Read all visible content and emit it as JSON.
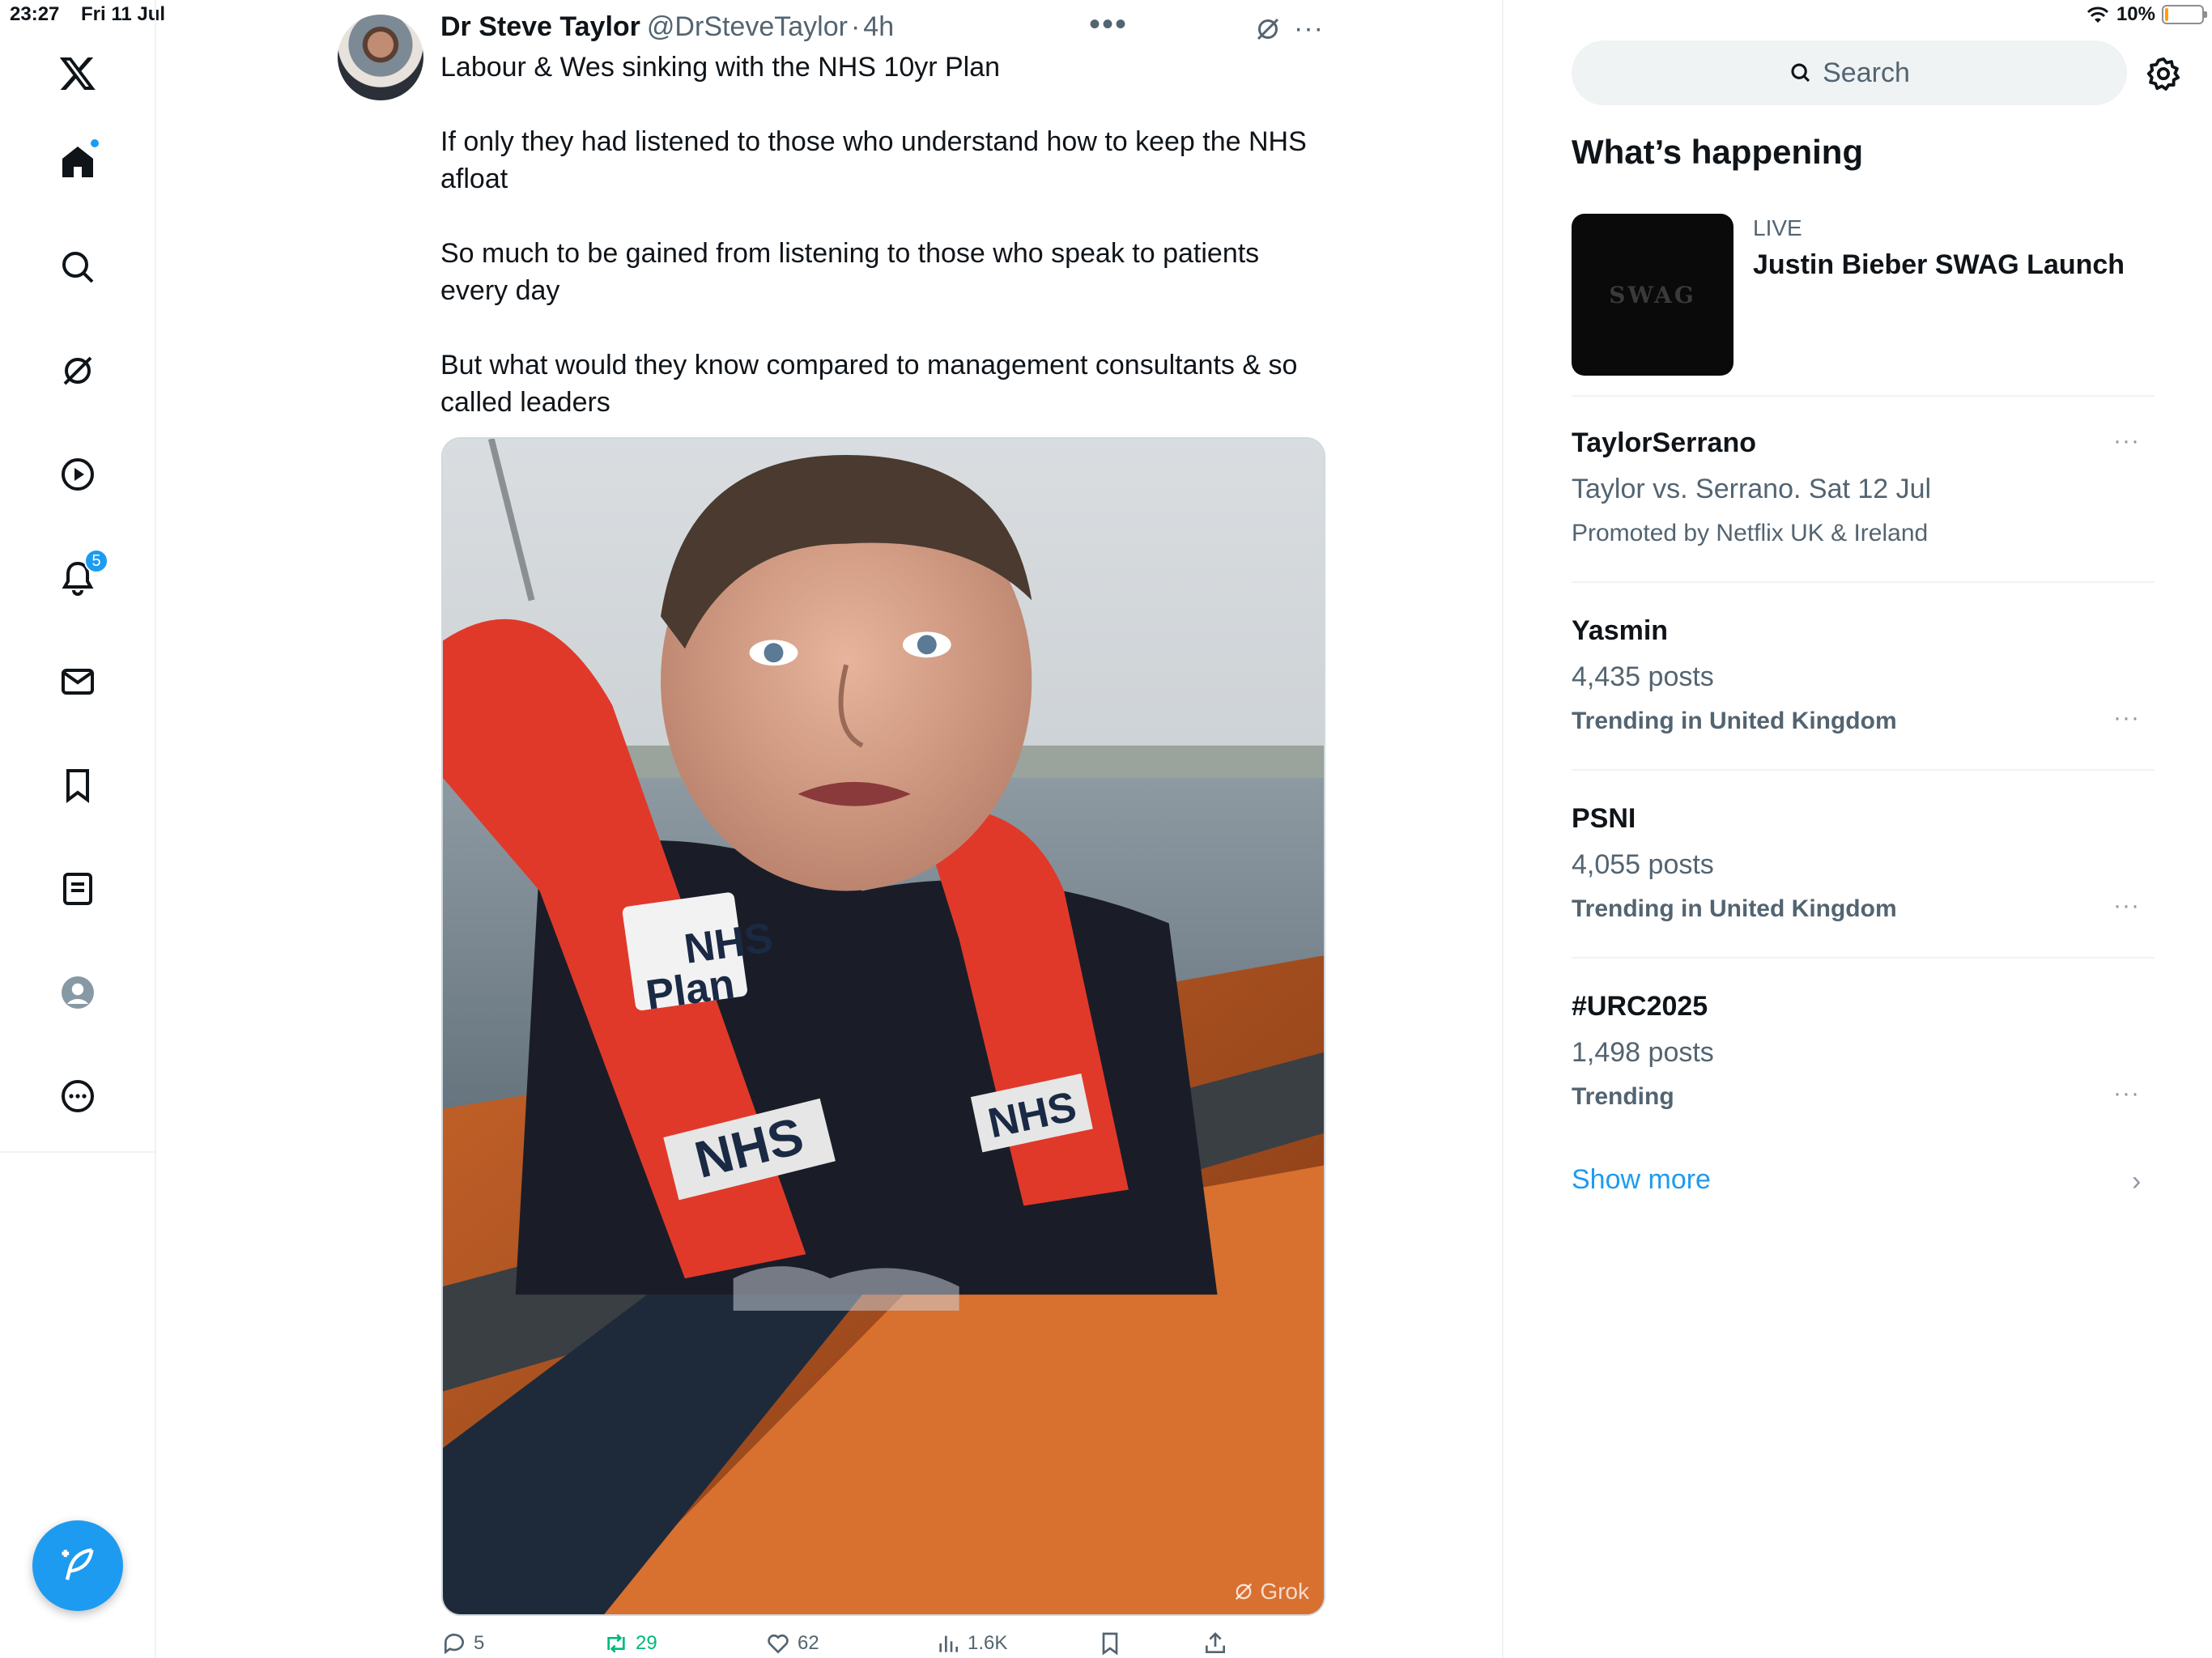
{
  "status_bar": {
    "time": "23:27",
    "date": "Fri 11 Jul",
    "battery_text": "10%",
    "battery_level": 0.1
  },
  "nav": {
    "items": [
      "X logo",
      "Home",
      "Search",
      "Grok",
      "Video",
      "Notifications",
      "Messages",
      "Bookmarks",
      "Lists",
      "Profile",
      "More"
    ],
    "notifications_badge": "5",
    "compose_label": "Compose"
  },
  "tweet": {
    "author_name": "Dr Steve Taylor",
    "author_handle": "@DrSteveTaylor",
    "separator": "·",
    "time_ago": "4h",
    "paragraphs": [
      "Labour & Wes sinking with the NHS 10yr Plan",
      "If only they had listened to those who understand how to keep the NHS afloat",
      "So much to be gained from listening to those who speak to patients every day",
      "But what would they know compared to management consultants & so called leaders"
    ],
    "media": {
      "lifejacket_text_1": "NHS",
      "lifejacket_text_2": "Plan",
      "lifejacket_text_3": "NHS",
      "lifejacket_text_4": "NHS",
      "watermark": "Grok"
    },
    "actions": {
      "replies": "5",
      "reposts": "29",
      "likes": "62",
      "views": "1.6K"
    }
  },
  "sidebar": {
    "search_placeholder": "Search",
    "section_title": "What’s happening",
    "live": {
      "label": "LIVE",
      "title": "Justin Bieber SWAG Launch",
      "thumb_text": "SWAG"
    },
    "trends": [
      {
        "title": "TaylorSerrano",
        "subtitle": "Taylor vs. Serrano. Sat 12 Jul",
        "meta": "Promoted by Netflix UK & Ireland"
      },
      {
        "title": "Yasmin",
        "subtitle": "4,435 posts",
        "meta": "Trending in United Kingdom"
      },
      {
        "title": "PSNI",
        "subtitle": "4,055 posts",
        "meta": "Trending in United Kingdom"
      },
      {
        "title": "#URC2025",
        "subtitle": "1,498 posts",
        "meta": "Trending"
      }
    ],
    "show_more": "Show more"
  },
  "colors": {
    "accent": "#1d9bf0",
    "repost_green": "#00ba7c",
    "text_primary": "#0f1419",
    "text_secondary": "#536471"
  }
}
